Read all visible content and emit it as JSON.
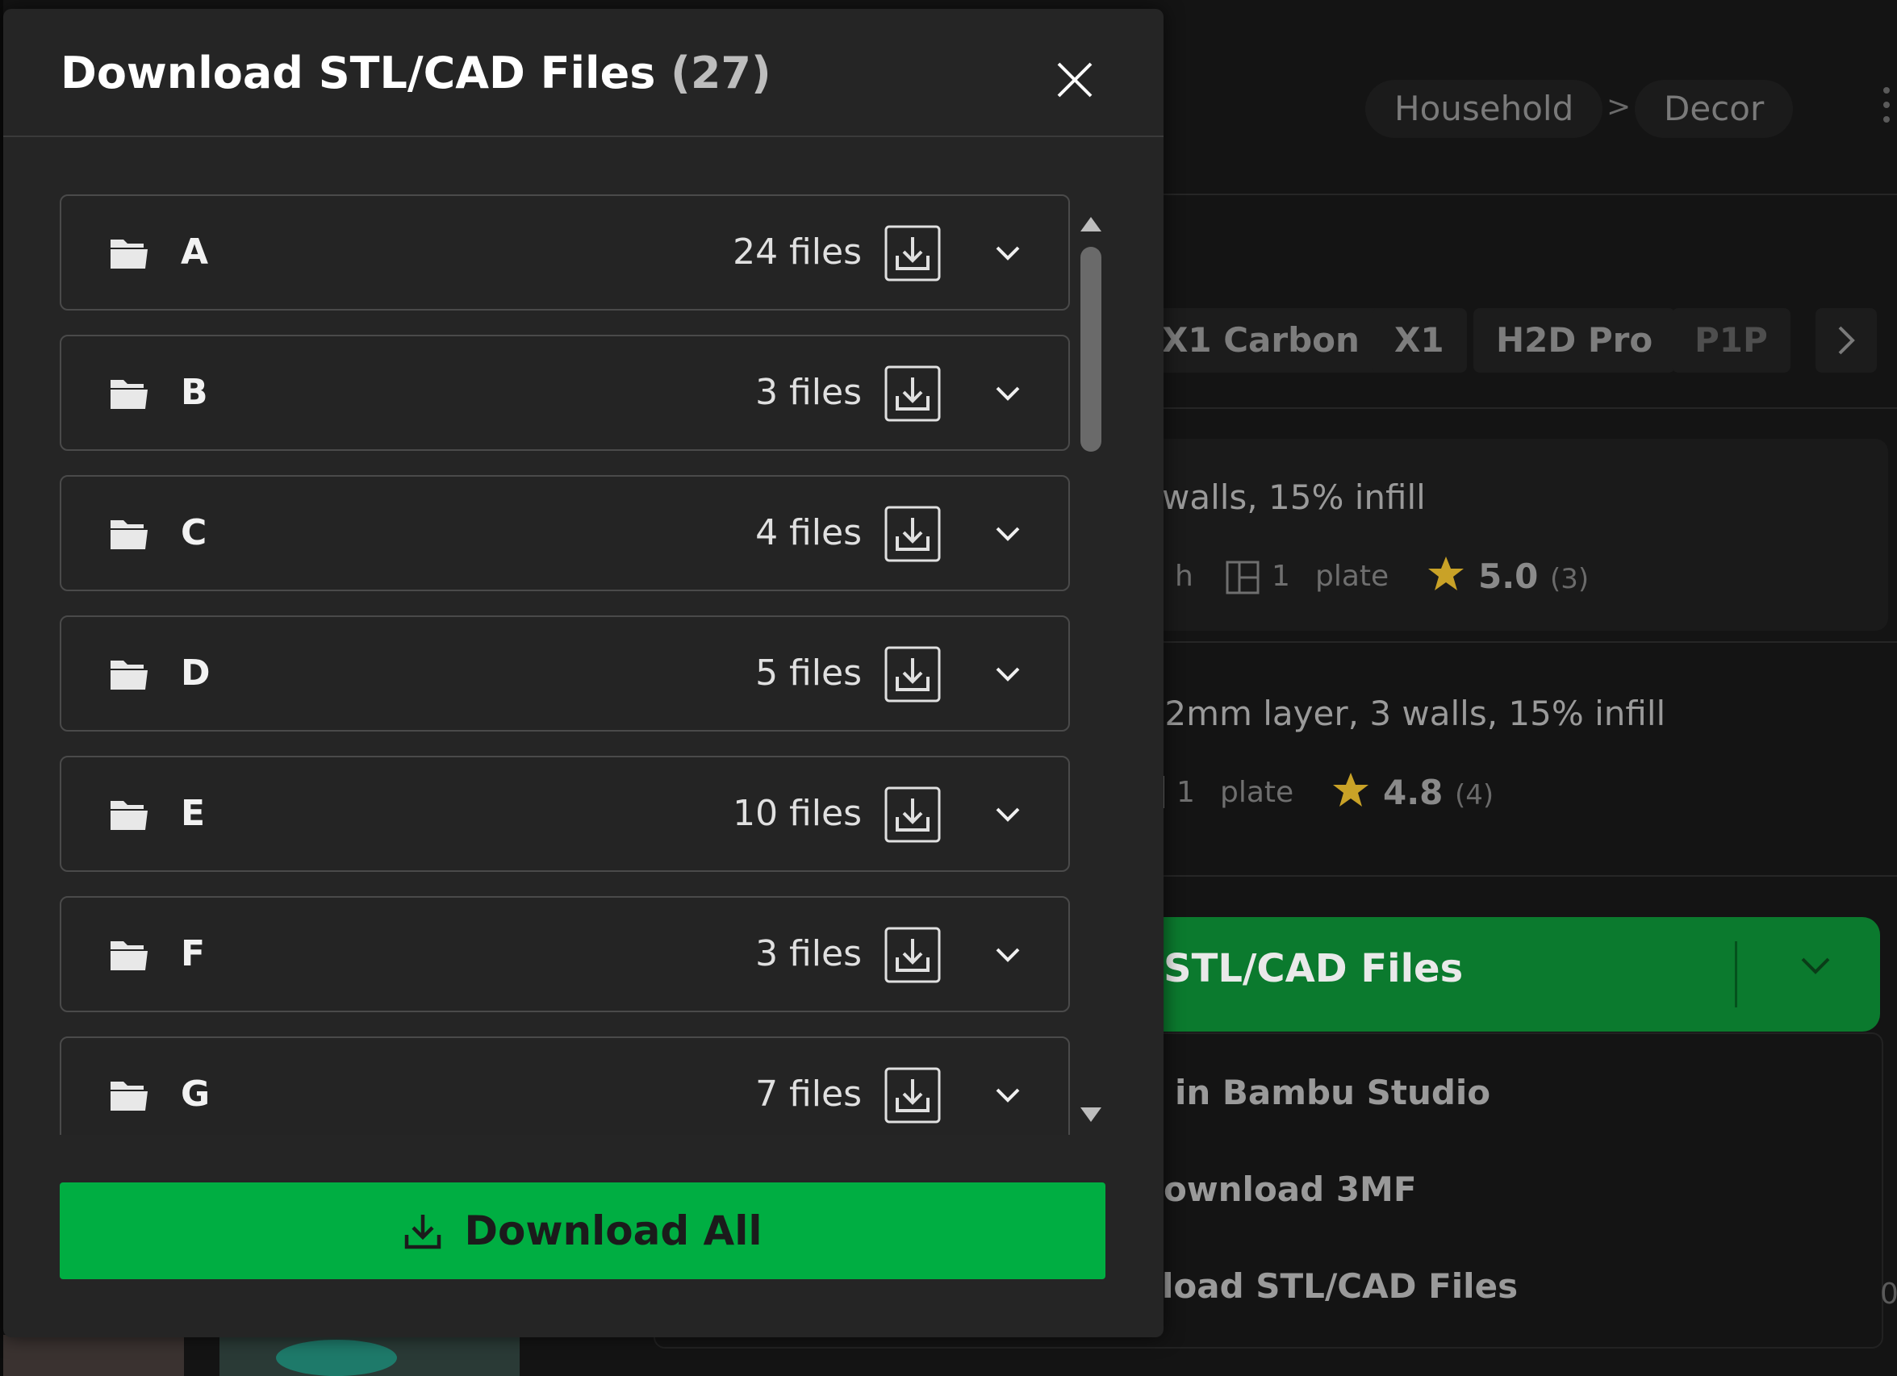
{
  "background": {
    "breadcrumb": [
      "Household",
      "Decor"
    ],
    "breadcrumb_separator": ">",
    "printer_chips": [
      "X1 Carbon",
      "X1",
      "H2D Pro",
      "P1P"
    ],
    "profiles": [
      {
        "title": "walls, 15% infill",
        "time_fragment": "h",
        "plates": "1",
        "plate_label": "plate",
        "rating": "5.0",
        "rating_count": "(3)"
      },
      {
        "title": ".2mm layer, 3 walls, 15% infill",
        "plates": "1",
        "plate_label": "plate",
        "rating": "4.8",
        "rating_count": "(4)"
      }
    ],
    "main_button_label": "STL/CAD Files",
    "dropdown_items": [
      "in Bambu Studio",
      "ownload 3MF",
      "load STL/CAD Files"
    ],
    "edge_fragment": "0"
  },
  "modal": {
    "title": "Download STL/CAD Files",
    "count": "(27)",
    "folders": [
      {
        "name": "A",
        "files": "24 files"
      },
      {
        "name": "B",
        "files": "3 files"
      },
      {
        "name": "C",
        "files": "4 files"
      },
      {
        "name": "D",
        "files": "5 files"
      },
      {
        "name": "E",
        "files": "10 files"
      },
      {
        "name": "F",
        "files": "3 files"
      },
      {
        "name": "G",
        "files": "7 files"
      }
    ],
    "download_all_label": "Download All"
  },
  "colors": {
    "accent_green": "#00ae42",
    "modal_bg": "#252525",
    "star": "#c9a227"
  }
}
